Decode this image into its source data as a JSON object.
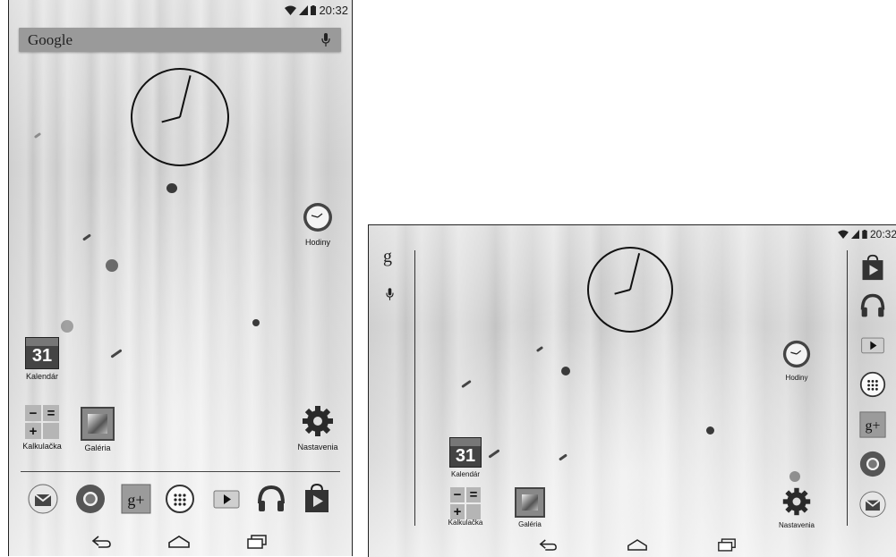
{
  "status": {
    "time": "20:32"
  },
  "search": {
    "logo": "Google"
  },
  "apps": {
    "clock": "Hodiny",
    "calendar": "Kalendár",
    "calendar_day": "31",
    "calculator": "Kalkulačka",
    "gallery": "Galéria",
    "settings": "Nastavenia"
  },
  "landscape_search": {
    "logo": "g"
  },
  "icons": [
    "wifi-icon",
    "signal-icon",
    "battery-icon",
    "mic-icon",
    "back-icon",
    "home-icon",
    "recents-icon",
    "app-drawer-icon",
    "play-store-icon",
    "play-music-icon",
    "play-movies-icon",
    "google-plus-icon",
    "chrome-icon",
    "gmail-icon",
    "settings-icon"
  ]
}
